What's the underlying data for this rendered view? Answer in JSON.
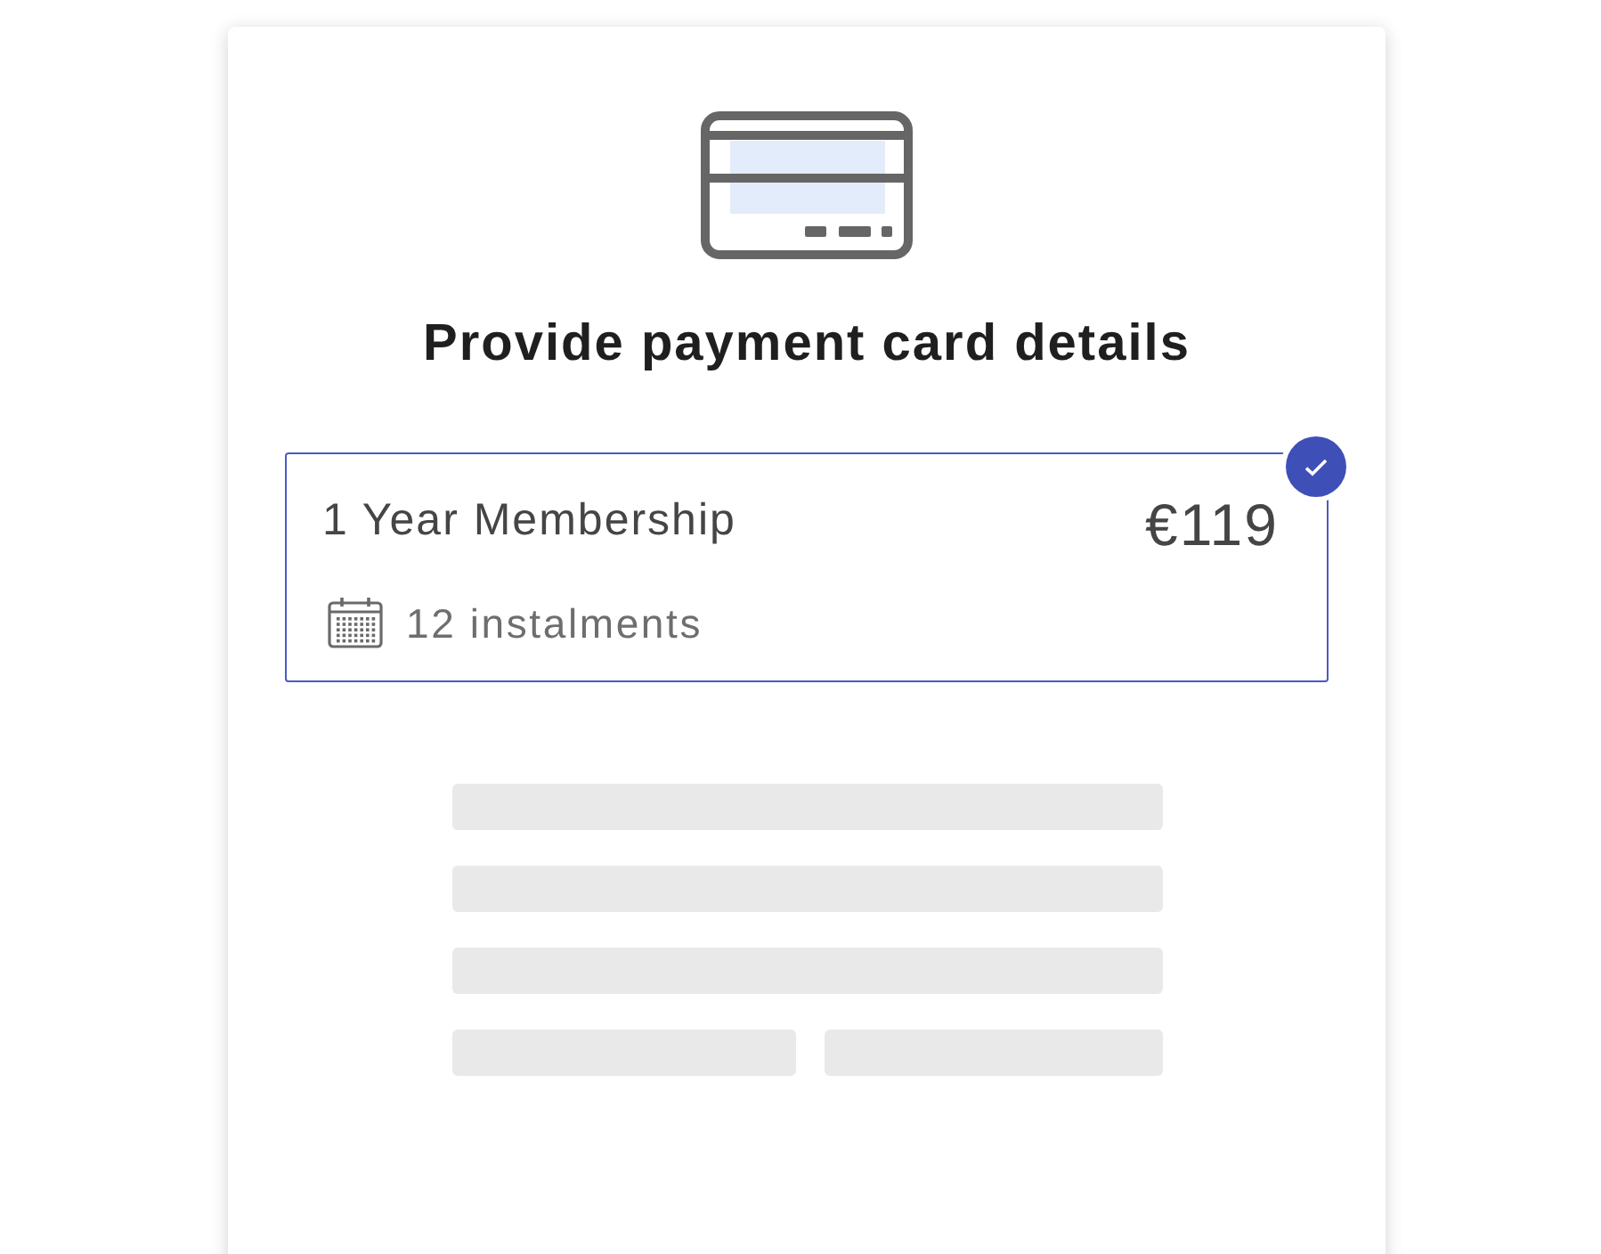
{
  "title": "Provide payment card details",
  "plans": [
    {
      "name": "1 Year Membership",
      "price": "€119",
      "instalments": "12 instalments",
      "selected": true
    }
  ],
  "payment_form": {
    "loading": true
  }
}
